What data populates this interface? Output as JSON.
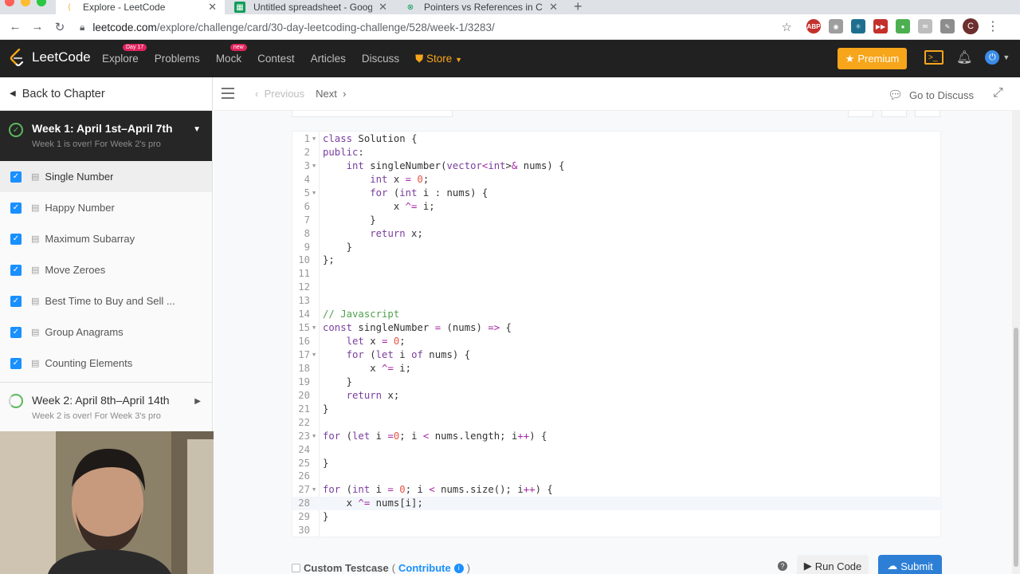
{
  "browser": {
    "tabs": [
      {
        "title": "Explore - LeetCode",
        "active": true
      },
      {
        "title": "Untitled spreadsheet - Google",
        "active": false
      },
      {
        "title": "Pointers vs References in C++",
        "active": false
      }
    ],
    "url_host": "leetcode.com",
    "url_path": "/explore/challenge/card/30-day-leetcoding-challenge/528/week-1/3283/",
    "profile_initial": "C"
  },
  "nav": {
    "logo_text": "LeetCode",
    "links": [
      "Explore",
      "Problems",
      "Mock",
      "Contest",
      "Articles",
      "Discuss"
    ],
    "explore_badge": "Day 17",
    "mock_badge": "new",
    "store_label": "Store",
    "premium_label": "Premium"
  },
  "sidebar": {
    "back_label": "Back to Chapter",
    "week1": {
      "title": "Week 1: April 1st–April 7th",
      "subtitle": "Week 1 is over! For Week 2's pro"
    },
    "items": [
      "Single Number",
      "Happy Number",
      "Maximum Subarray",
      "Move Zeroes",
      "Best Time to Buy and Sell ...",
      "Group Anagrams",
      "Counting Elements"
    ],
    "week2": {
      "title": "Week 2: April 8th–April 14th",
      "subtitle": "Week 2 is over! For Week 3's pro"
    }
  },
  "toolbar": {
    "previous_label": "Previous",
    "next_label": "Next",
    "discuss_label": "Go to Discuss"
  },
  "editor": {
    "current_line": 28,
    "lines": [
      "class Solution {",
      "public:",
      "    int singleNumber(vector<int>& nums) {",
      "        int x = 0;",
      "        for (int i : nums) {",
      "            x ^= i;",
      "        }",
      "        return x;",
      "    }",
      "};",
      "",
      "",
      "",
      "// Javascript",
      "const singleNumber = (nums) => {",
      "    let x = 0;",
      "    for (let i of nums) {",
      "        x ^= i;",
      "    }",
      "    return x;",
      "}",
      "",
      "for (let i =0; i < nums.length; i++) {",
      "",
      "}",
      "",
      "for (int i = 0; i < nums.size(); i++) {",
      "    x ^= nums[i];",
      "}",
      ""
    ]
  },
  "bottom": {
    "custom_testcase_label": "Custom Testcase",
    "contribute_label": "Contribute",
    "run_label": "Run Code",
    "submit_label": "Submit"
  }
}
